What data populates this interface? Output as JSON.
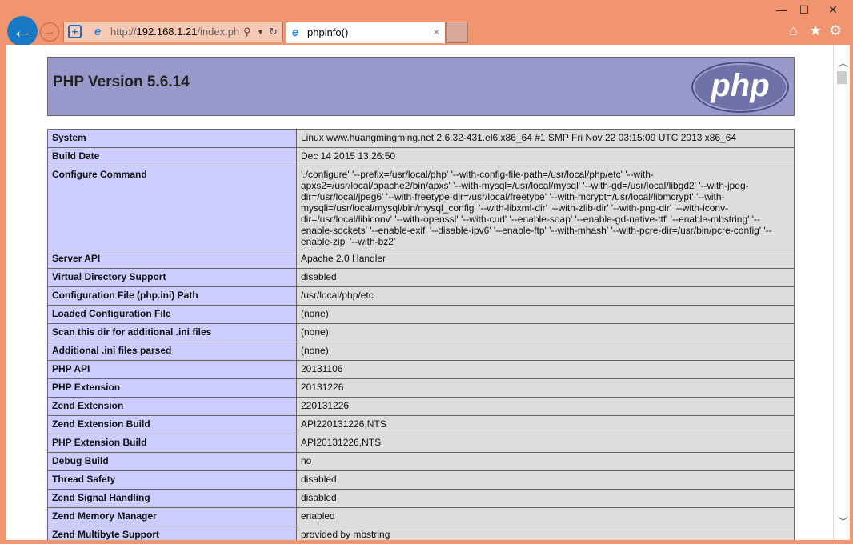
{
  "browser": {
    "url_prefix": "http://",
    "url_host": "192.168.1.21",
    "url_path": "/index.ph",
    "tab_title": "phpinfo()",
    "tab_close": "×",
    "minimize": "—",
    "maximize": "☐",
    "close": "✕"
  },
  "page": {
    "title": "PHP Version 5.6.14",
    "logo_text": "php"
  },
  "rows": [
    {
      "label": "System",
      "value": "Linux www.huangmingming.net 2.6.32-431.el6.x86_64 #1 SMP Fri Nov 22 03:15:09 UTC 2013 x86_64"
    },
    {
      "label": "Build Date",
      "value": "Dec 14 2015 13:26:50"
    },
    {
      "label": "Configure Command",
      "value": "'./configure' '--prefix=/usr/local/php' '--with-config-file-path=/usr/local/php/etc' '--with-apxs2=/usr/local/apache2/bin/apxs' '--with-mysql=/usr/local/mysql' '--with-gd=/usr/local/libgd2' '--with-jpeg-dir=/usr/local/jpeg6' '--with-freetype-dir=/usr/local/freetype' '--with-mcrypt=/usr/local/libmcrypt' '--with-mysqli=/usr/local/mysql/bin/mysql_config' '--with-libxml-dir' '--with-zlib-dir' '--with-png-dir' '--with-iconv-dir=/usr/local/libiconv' '--with-openssl' '--with-curl' '--enable-soap' '--enable-gd-native-ttf' '--enable-mbstring' '--enable-sockets' '--enable-exif' '--disable-ipv6' '--enable-ftp' '--with-mhash' '--with-pcre-dir=/usr/bin/pcre-config' '--enable-zip' '--with-bz2'"
    },
    {
      "label": "Server API",
      "value": "Apache 2.0 Handler"
    },
    {
      "label": "Virtual Directory Support",
      "value": "disabled"
    },
    {
      "label": "Configuration File (php.ini) Path",
      "value": "/usr/local/php/etc"
    },
    {
      "label": "Loaded Configuration File",
      "value": "(none)"
    },
    {
      "label": "Scan this dir for additional .ini files",
      "value": "(none)"
    },
    {
      "label": "Additional .ini files parsed",
      "value": "(none)"
    },
    {
      "label": "PHP API",
      "value": "20131106"
    },
    {
      "label": "PHP Extension",
      "value": "20131226"
    },
    {
      "label": "Zend Extension",
      "value": "220131226"
    },
    {
      "label": "Zend Extension Build",
      "value": "API220131226,NTS"
    },
    {
      "label": "PHP Extension Build",
      "value": "API20131226,NTS"
    },
    {
      "label": "Debug Build",
      "value": "no"
    },
    {
      "label": "Thread Safety",
      "value": "disabled"
    },
    {
      "label": "Zend Signal Handling",
      "value": "disabled"
    },
    {
      "label": "Zend Memory Manager",
      "value": "enabled"
    },
    {
      "label": "Zend Multibyte Support",
      "value": "provided by mbstring"
    }
  ]
}
